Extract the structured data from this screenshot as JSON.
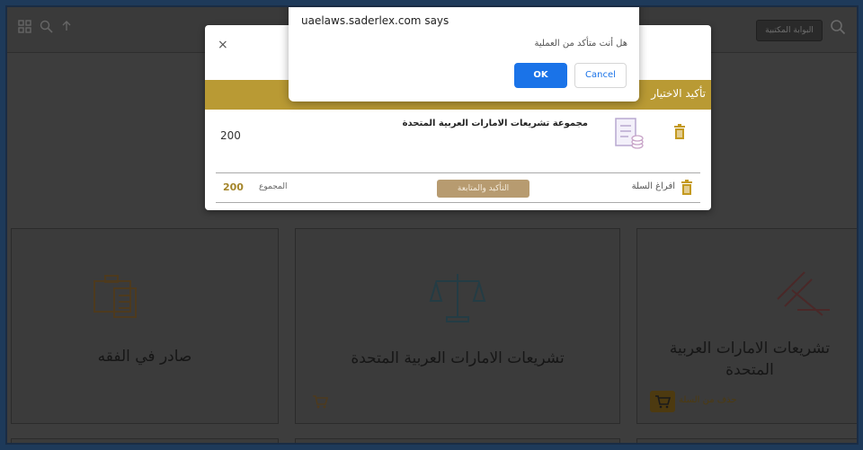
{
  "alert": {
    "title": "uaelaws.saderlex.com says",
    "message": "هل أنت متأكد من العملية",
    "ok_label": "OK",
    "cancel_label": "Cancel"
  },
  "modal": {
    "close_glyph": "×",
    "band_title": "تأكيد الاختيار",
    "item": {
      "title": "مجموعة تشريعات الامارات العربية المتحدة",
      "price": "200"
    },
    "empty_cart_label": "افراغ السلة",
    "confirm_label": "التأكيد والمتابعة",
    "total_label": "المجموع",
    "total_value": "200"
  },
  "topbar": {
    "action_button_label": "البوابة المكتبية"
  },
  "cards": [
    {
      "title": "صادر في الفقه"
    },
    {
      "title": "تشريعات الامارات العربية المتحدة"
    },
    {
      "title_line1": "تشريعات الامارات العربية",
      "title_line2": "المتحدة",
      "remove_label": "حذف من السلة"
    }
  ],
  "colors": {
    "gold": "#b99a34",
    "confirm": "#b79b70",
    "ok_blue": "#1a73e8",
    "dim_background": "#3d3d3d"
  },
  "icons": [
    "grid-icon",
    "search-icon",
    "trash-icon",
    "cart-icon",
    "document-icon",
    "scales-icon",
    "briefcase-icon",
    "gavel-icon",
    "close-icon"
  ]
}
